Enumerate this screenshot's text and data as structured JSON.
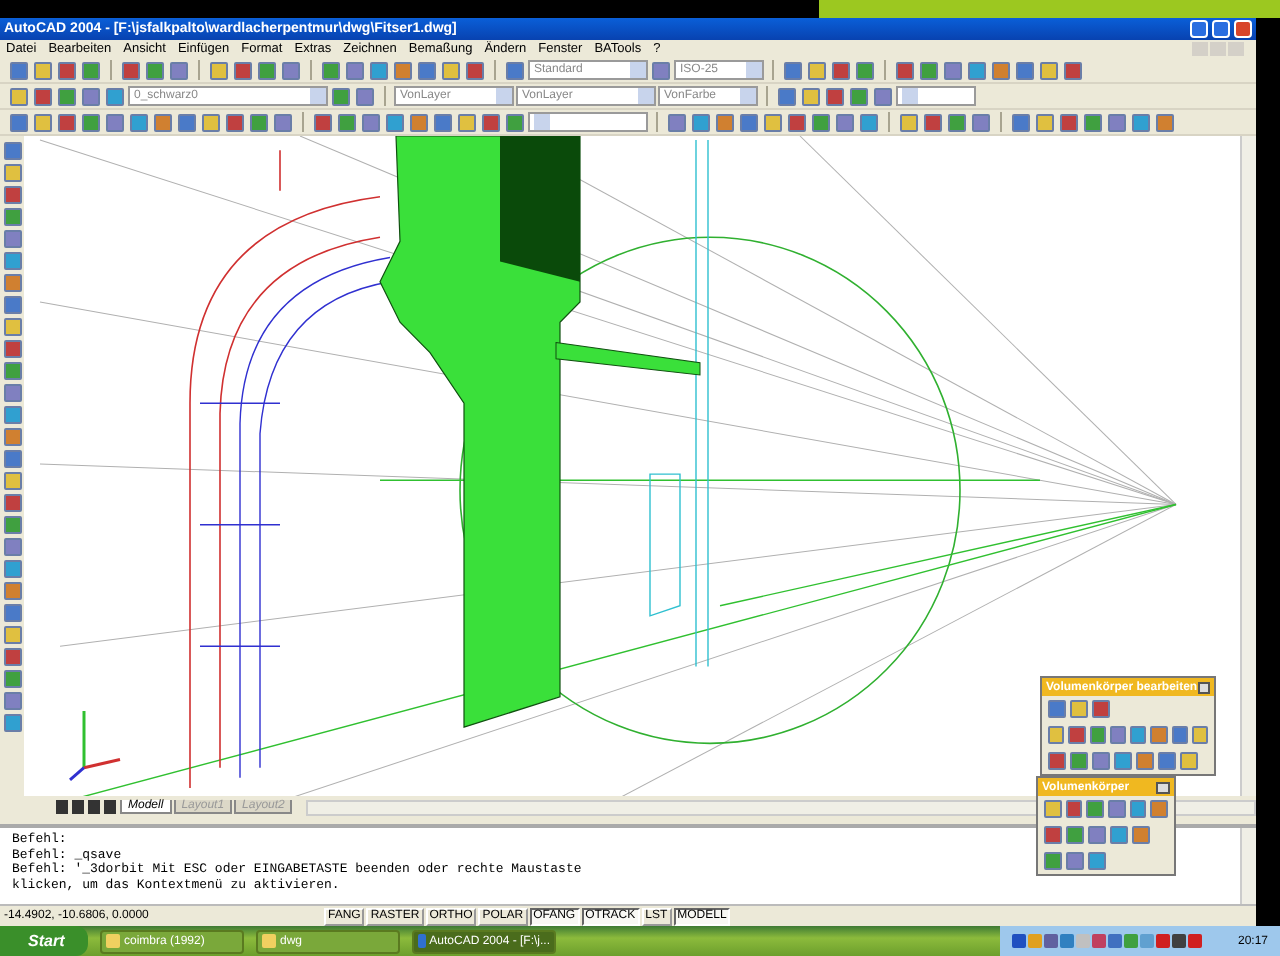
{
  "window": {
    "title": "AutoCAD 2004 - [F:\\jsfalkpalto\\wardlacherpentmur\\dwg\\Fitser1.dwg]"
  },
  "menu": [
    "Datei",
    "Bearbeiten",
    "Ansicht",
    "Einfügen",
    "Format",
    "Extras",
    "Zeichnen",
    "Bemaßung",
    "Ändern",
    "Fenster",
    "BATools",
    "?"
  ],
  "toolbars": {
    "text_style": "Standard",
    "dim_style": "ISO-25",
    "layer": "0_schwarz0",
    "layer_color": "VonLayer",
    "linetype": "VonLayer",
    "lineweight": "VonFarbe"
  },
  "layout_tabs": [
    {
      "label": "Modell",
      "selected": true
    },
    {
      "label": "Layout1",
      "selected": false
    },
    {
      "label": "Layout2",
      "selected": false
    }
  ],
  "command_lines": [
    "Befehl:",
    "Befehl: _qsave",
    "Befehl: '_3dorbit Mit ESC oder EINGABETASTE beenden oder rechte Maustaste",
    "klicken, um das Kontextmenü zu aktivieren."
  ],
  "status_bar": {
    "coordinates": "-14.4902, -10.6806, 0.0000",
    "toggles": [
      {
        "label": "FANG",
        "on": false
      },
      {
        "label": "RASTER",
        "on": false
      },
      {
        "label": "ORTHO",
        "on": false
      },
      {
        "label": "POLAR",
        "on": false
      },
      {
        "label": "OFANG",
        "on": true
      },
      {
        "label": "OTRACK",
        "on": true
      },
      {
        "label": "LST",
        "on": false
      },
      {
        "label": "MODELL",
        "on": true
      }
    ]
  },
  "palettes": [
    {
      "title": "Volumenkörper bearbeiten"
    },
    {
      "title": "Volumenkörper"
    }
  ],
  "taskbar": {
    "start": "Start",
    "tasks": [
      {
        "label": "coimbra (1992)",
        "kind": "folder",
        "selected": false
      },
      {
        "label": "dwg",
        "kind": "folder",
        "selected": false
      },
      {
        "label": "AutoCAD 2004 - [F:\\j...",
        "kind": "app",
        "selected": true
      }
    ],
    "clock": "20:17"
  }
}
